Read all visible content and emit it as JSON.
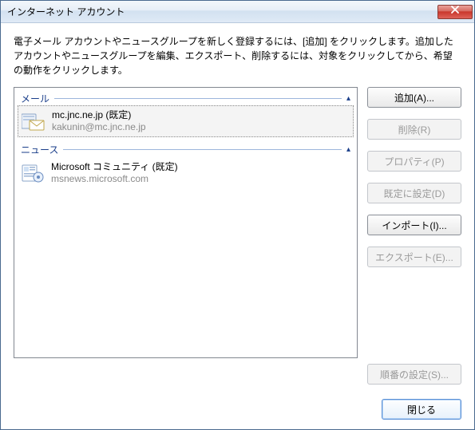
{
  "window": {
    "title": "インターネット アカウント"
  },
  "instructions": "電子メール アカウントやニュースグループを新しく登録するには、[追加] をクリックします。追加したアカウントやニュースグループを編集、エクスポート、削除するには、対象をクリックしてから、希望の動作をクリックします。",
  "groups": {
    "mail": {
      "label": "メール"
    },
    "news": {
      "label": "ニュース"
    }
  },
  "accounts": {
    "mail": {
      "title": "mc.jnc.ne.jp (既定)",
      "sub": "kakunin@mc.jnc.ne.jp"
    },
    "news": {
      "title": "Microsoft コミュニティ (既定)",
      "sub": "msnews.microsoft.com"
    }
  },
  "buttons": {
    "add": "追加(A)...",
    "remove": "削除(R)",
    "properties": "プロパティ(P)",
    "set_default": "既定に設定(D)",
    "import": "インポート(I)...",
    "export": "エクスポート(E)...",
    "set_order": "順番の設定(S)...",
    "close": "閉じる"
  }
}
